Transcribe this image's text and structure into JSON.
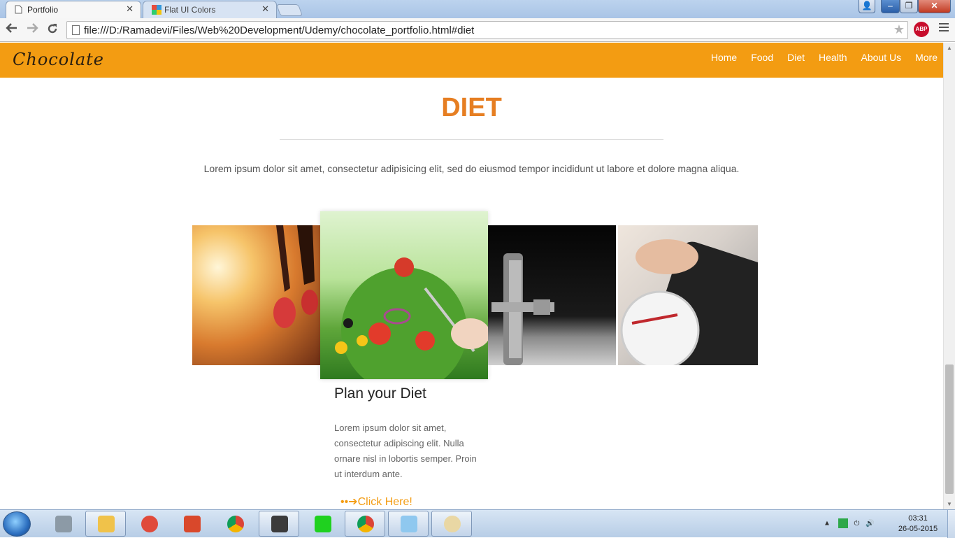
{
  "browser": {
    "tabs": [
      {
        "title": "Portfolio",
        "active": true
      },
      {
        "title": "Flat UI Colors",
        "active": false
      }
    ],
    "address": "file:///D:/Ramadevi/Files/Web%20Development/Udemy/chocolate_portfolio.html#diet",
    "icons": {
      "back": "back-arrow-icon",
      "forward": "forward-arrow-icon",
      "reload": "reload-icon",
      "star": "bookmark-star-icon",
      "abp": "adblock-plus-icon",
      "menu": "hamburger-menu-icon"
    },
    "abp_label": "ABP"
  },
  "site": {
    "brand": "Chocolate",
    "nav": [
      "Home",
      "Food",
      "Diet",
      "Health",
      "About Us",
      "More"
    ],
    "accent": "#f39c12",
    "title_color": "#e67e22"
  },
  "section": {
    "title": "DIET",
    "intro": "Lorem ipsum dolor sit amet, consectetur adipisicing elit, sed do eiusmod tempor incididunt ut labore et dolore magna aliqua.",
    "images": [
      {
        "name": "running-shoes-image"
      },
      {
        "name": "salad-image"
      },
      {
        "name": "dumbbell-weights-image"
      },
      {
        "name": "bathroom-scale-image"
      }
    ],
    "card": {
      "title": "Plan your Diet",
      "text": "Lorem ipsum dolor sit amet, consectetur adipiscing elit. Nulla ornare nisl in lobortis semper. Proin ut interdum ante.",
      "link": "Click Here!"
    }
  },
  "taskbar": {
    "apps": [
      "network-tool-icon",
      "file-explorer-icon",
      "app-icon-red-star",
      "paint-app-icon",
      "chrome-icon",
      "sublime-text-icon",
      "chip-emulator-icon",
      "chrome-icon",
      "notepad-icon",
      "paint-palette-icon"
    ],
    "time": "03:31",
    "date": "26-05-2015"
  }
}
